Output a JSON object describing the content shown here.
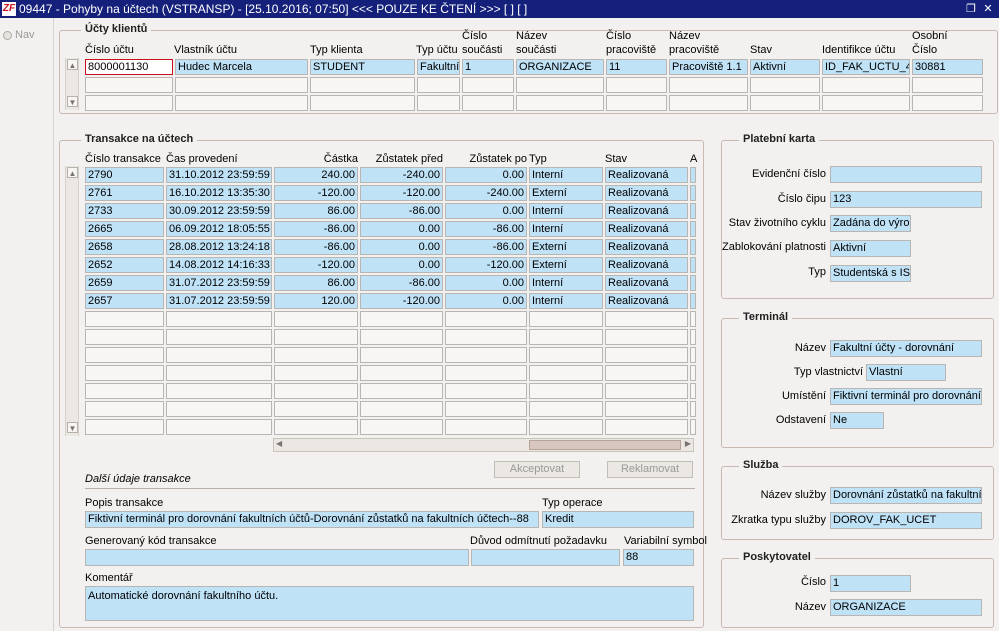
{
  "window": {
    "title": "09447 - Pohyby na účtech (VSTRANSP) - [25.10.2016; 07:50] <<< POUZE KE ČTENÍ >>>  [ ]  [ ]",
    "app_icon_text": "ZF"
  },
  "nav": {
    "label": "Nav"
  },
  "accounts": {
    "legend": "Účty klientů",
    "headers": {
      "cislo_uctu": "Číslo účtu",
      "vlastnik": "Vlastník účtu",
      "typ_klienta": "Typ klienta",
      "typ_uctu": "Typ účtu",
      "cislo_soucasti_1": "Číslo",
      "cislo_soucasti_2": "součásti",
      "nazev_soucasti_1": "Název",
      "nazev_soucasti_2": "součásti",
      "cislo_prac_1": "Číslo",
      "cislo_prac_2": "pracoviště",
      "nazev_prac_1": "Název",
      "nazev_prac_2": "pracoviště",
      "stav": "Stav",
      "identifikace": "Identifikce účtu",
      "osobni_1": "Osobní",
      "osobni_2": "Číslo"
    },
    "row": {
      "cislo_uctu": "8000001130",
      "vlastnik": "Hudec Marcela",
      "typ_klienta": "STUDENT",
      "typ_uctu": "Fakultní",
      "cislo_soucasti": "1",
      "nazev_soucasti": "ORGANIZACE",
      "cislo_prac": "11",
      "nazev_prac": "Pracoviště 1.1",
      "stav": "Aktivní",
      "identifikace": "ID_FAK_UCTU_4",
      "osobni": "30881"
    }
  },
  "transactions": {
    "legend": "Transakce na účtech",
    "headers": {
      "cislo": "Číslo transakce",
      "cas": "Čas provedení",
      "castka": "Částka",
      "zustatek_pred": "Zůstatek před",
      "zustatek_po": "Zůstatek po",
      "typ": "Typ",
      "stav": "Stav",
      "extra": "A"
    },
    "rows": [
      {
        "cislo": "2790",
        "cas": "31.10.2012 23:59:59",
        "castka": "240.00",
        "pred": "-240.00",
        "po": "0.00",
        "typ": "Interní",
        "stav": "Realizovaná"
      },
      {
        "cislo": "2761",
        "cas": "16.10.2012 13:35:30",
        "castka": "-120.00",
        "pred": "-120.00",
        "po": "-240.00",
        "typ": "Externí",
        "stav": "Realizovaná"
      },
      {
        "cislo": "2733",
        "cas": "30.09.2012 23:59:59",
        "castka": "86.00",
        "pred": "-86.00",
        "po": "0.00",
        "typ": "Interní",
        "stav": "Realizovaná"
      },
      {
        "cislo": "2665",
        "cas": "06.09.2012 18:05:55",
        "castka": "-86.00",
        "pred": "0.00",
        "po": "-86.00",
        "typ": "Interní",
        "stav": "Realizovaná"
      },
      {
        "cislo": "2658",
        "cas": "28.08.2012 13:24:18",
        "castka": "-86.00",
        "pred": "0.00",
        "po": "-86.00",
        "typ": "Externí",
        "stav": "Realizovaná"
      },
      {
        "cislo": "2652",
        "cas": "14.08.2012 14:16:33",
        "castka": "-120.00",
        "pred": "0.00",
        "po": "-120.00",
        "typ": "Externí",
        "stav": "Realizovaná"
      },
      {
        "cislo": "2659",
        "cas": "31.07.2012 23:59:59",
        "castka": "86.00",
        "pred": "-86.00",
        "po": "0.00",
        "typ": "Interní",
        "stav": "Realizovaná"
      },
      {
        "cislo": "2657",
        "cas": "31.07.2012 23:59:59",
        "castka": "120.00",
        "pred": "-120.00",
        "po": "0.00",
        "typ": "Interní",
        "stav": "Realizovaná"
      }
    ],
    "buttons": {
      "accept": "Akceptovat",
      "complain": "Reklamovat"
    }
  },
  "details": {
    "section_title": "Další údaje transakce",
    "popis_label": "Popis transakce",
    "popis_value": "Fiktivní terminál pro dorovnání fakultních účtů-Dorovnání zůstatků na fakultních účtech--88",
    "typ_operace_label": "Typ operace",
    "typ_operace_value": "Kredit",
    "gen_kod_label": "Generovaný kód transakce",
    "gen_kod_value": "",
    "duvod_label": "Důvod odmítnutí požadavku",
    "duvod_value": "",
    "var_symbol_label": "Variabilní symbol",
    "var_symbol_value": "88",
    "komentar_label": "Komentář",
    "komentar_value": "Automatické dorovnání fakultního účtu."
  },
  "card": {
    "legend": "Platební karta",
    "evid_label": "Evidenční číslo",
    "evid_value": "",
    "cip_label": "Číslo čipu",
    "cip_value": "123",
    "zivot_label": "Stav životního cyklu",
    "zivot_value": "Zadána do výro",
    "zablok_label": "Zablokování platnosti",
    "zablok_value": "Aktivní",
    "typ_label": "Typ",
    "typ_value": "Studentská s IS"
  },
  "terminal": {
    "legend": "Terminál",
    "nazev_label": "Název",
    "nazev_value": "Fakultní účty - dorovnání",
    "vlastnictvi_label": "Typ vlastnictví",
    "vlastnictvi_value": "Vlastní",
    "umisteni_label": "Umístění",
    "umisteni_value": "Fiktivní terminál pro dorovnání f",
    "odstaveni_label": "Odstavení",
    "odstaveni_value": "Ne"
  },
  "service": {
    "legend": "Služba",
    "nazev_label": "Název služby",
    "nazev_value": "Dorovnání zůstatků na fakultníc",
    "zkratka_label": "Zkratka typu služby",
    "zkratka_value": "DOROV_FAK_UCET"
  },
  "provider": {
    "legend": "Poskytovatel",
    "cislo_label": "Číslo",
    "cislo_value": "1",
    "nazev_label": "Název",
    "nazev_value": "ORGANIZACE"
  },
  "colors": {
    "titlebar": "#14207a",
    "field_bg": "#bfe2f7",
    "empty_cell": "#f7f6f4",
    "active_border": "#c8101e",
    "frame_border": "#c9b9b1"
  }
}
